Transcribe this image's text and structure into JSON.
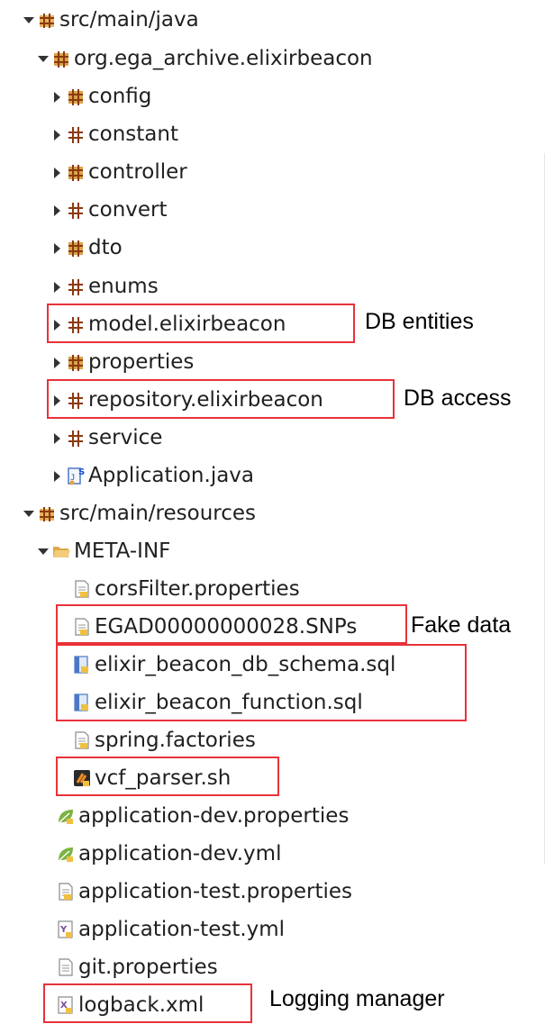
{
  "tree": {
    "src_main_java": "src/main/java",
    "package_root": "org.ega_archive.elixirbeacon",
    "packages": [
      "config",
      "constant",
      "controller",
      "convert",
      "dto",
      "enums",
      "model.elixirbeacon",
      "properties",
      "repository.elixirbeacon",
      "service"
    ],
    "application_java": "Application.java",
    "src_main_resources": "src/main/resources",
    "meta_inf": "META-INF",
    "meta_files": [
      "corsFilter.properties",
      "EGAD00000000028.SNPs",
      "elixir_beacon_db_schema.sql",
      "elixir_beacon_function.sql",
      "spring.factories",
      "vcf_parser.sh"
    ],
    "resource_files": [
      "application-dev.properties",
      "application-dev.yml",
      "application-test.properties",
      "application-test.yml",
      "git.properties",
      "logback.xml"
    ]
  },
  "annotations": {
    "db_entities": "DB entities",
    "db_access": "DB access",
    "fake_data": "Fake data",
    "logging_manager": "Logging manager"
  },
  "colors": {
    "highlight": "#e8323a",
    "package_icon": "#8b3a0f",
    "folder_icon": "#e0a84a"
  }
}
